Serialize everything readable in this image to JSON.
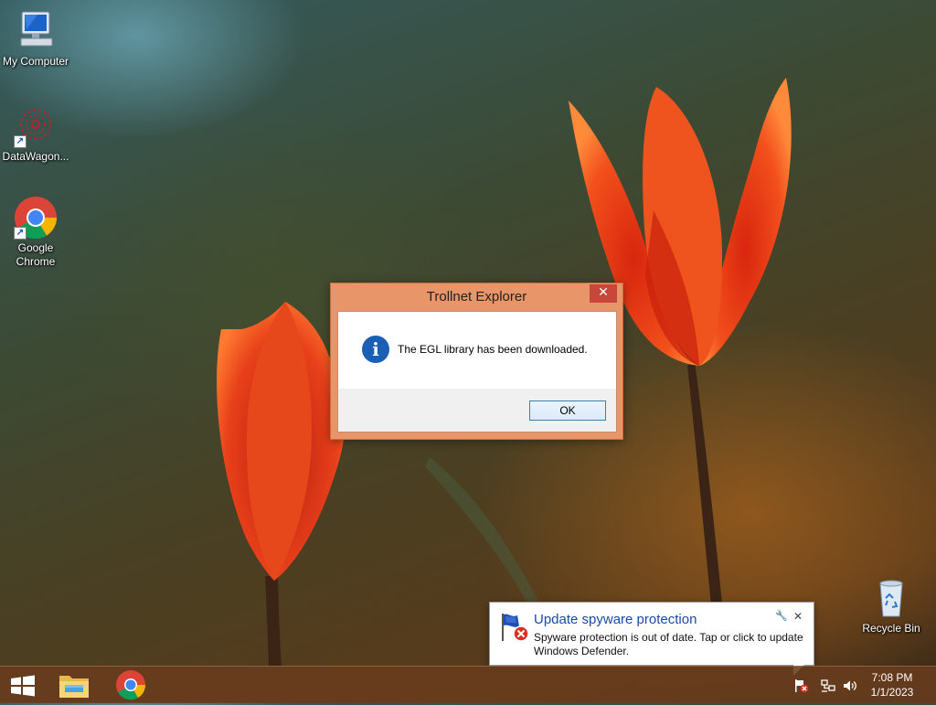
{
  "desktop": {
    "icons": [
      {
        "label": "My Computer",
        "icon": "computer-icon"
      },
      {
        "label": "DataWagon...",
        "icon": "datawagon-icon"
      },
      {
        "label": "Google Chrome",
        "icon": "chrome-icon"
      },
      {
        "label": "Recycle Bin",
        "icon": "recycle-bin-icon"
      }
    ]
  },
  "dialog": {
    "title": "Trollnet Explorer",
    "close_glyph": "✕",
    "icon": "info-icon",
    "icon_glyph": "i",
    "message": "The EGL library has been downloaded.",
    "ok_label": "OK"
  },
  "notification": {
    "icon": "defender-flag-icon",
    "title": "Update spyware protection",
    "text": "Spyware protection is out of date. Tap or click to update Windows Defender.",
    "wrench_glyph": "🔧",
    "close_glyph": "✕"
  },
  "taskbar": {
    "start_icon": "windows-start-icon",
    "apps": [
      {
        "name": "File Explorer",
        "icon": "file-explorer-icon"
      },
      {
        "name": "Google Chrome",
        "icon": "chrome-icon"
      }
    ],
    "tray": [
      "action-center-flag-icon",
      "network-icon",
      "volume-icon"
    ],
    "time": "7:08 PM",
    "date": "1/1/2023"
  },
  "colors": {
    "dialog_frame": "#e8956a",
    "dialog_close": "#c8473a",
    "taskbar": "#693c1e",
    "notification_title": "#1a4aa8"
  }
}
